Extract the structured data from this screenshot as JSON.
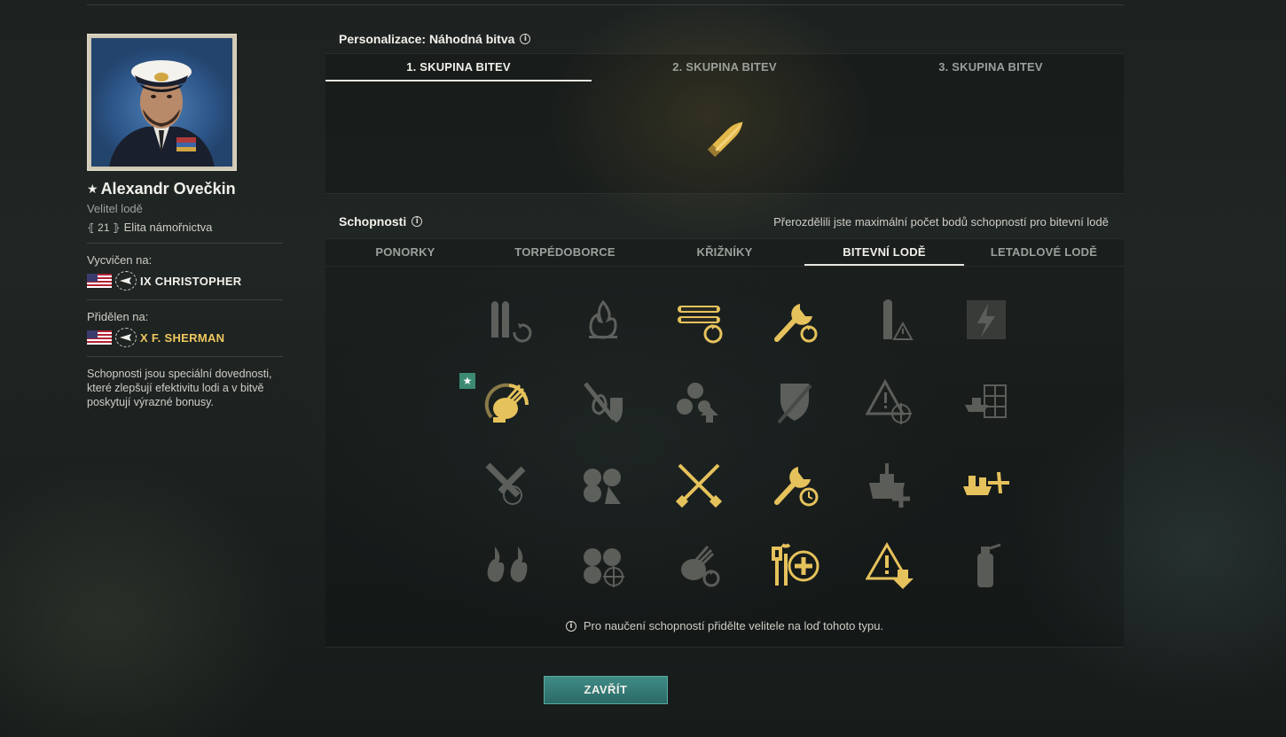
{
  "commander": {
    "name": "Alexandr Ovečkin",
    "role": "Velitel lodě",
    "level": "21",
    "rank_title": "Elita námořnictva",
    "trained_label": "Vycvičen na:",
    "trained_ship": "IX CHRISTOPHER",
    "assigned_label": "Přidělen na:",
    "assigned_ship": "X F. SHERMAN",
    "description": "Schopnosti jsou speciální dovednosti, které zlepšují efektivitu lodi a v bitvě poskytují výrazné bonusy."
  },
  "personalization": {
    "title": "Personalizace: Náhodná bitva",
    "tabs": [
      "1. SKUPINA BITEV",
      "2. SKUPINA BITEV",
      "3. SKUPINA BITEV"
    ],
    "active_tab": 0
  },
  "skills": {
    "title": "Schopnosti",
    "note": "Přerozdělili jste maximální počet bodů schopností pro bitevní lodě",
    "tabs": [
      "PONORKY",
      "TORPÉDOBORCE",
      "KŘIŽNÍKY",
      "BITEVNÍ LODĚ",
      "LETADLOVÉ LODĚ"
    ],
    "active_tab": 3,
    "grid": [
      [
        {
          "icon": "shells-reload-icon",
          "active": false
        },
        {
          "icon": "fire-icon",
          "active": false
        },
        {
          "icon": "torpedo-reload-icon",
          "active": true
        },
        {
          "icon": "wrench-reload-icon",
          "active": true
        },
        {
          "icon": "shell-warning-icon",
          "active": false
        },
        {
          "icon": "lightning-stripes-icon",
          "active": false
        }
      ],
      [
        {
          "icon": "aa-guns-icon",
          "active": true,
          "starred": true
        },
        {
          "icon": "fire-shield-icon",
          "active": false
        },
        {
          "icon": "propeller-up-icon",
          "active": false
        },
        {
          "icon": "shield-sword-icon",
          "active": false
        },
        {
          "icon": "warning-target-icon",
          "active": false
        },
        {
          "icon": "ship-grid-icon",
          "active": false
        }
      ],
      [
        {
          "icon": "crossed-shells-icon",
          "active": false
        },
        {
          "icon": "gun-sights-icon",
          "active": false
        },
        {
          "icon": "crossed-tools-icon",
          "active": true
        },
        {
          "icon": "wrench-timer-icon",
          "active": true
        },
        {
          "icon": "ship-heal-icon",
          "active": false
        },
        {
          "icon": "ship-plane-icon",
          "active": true
        }
      ],
      [
        {
          "icon": "fires-icon",
          "active": false
        },
        {
          "icon": "gun-targets-icon",
          "active": false
        },
        {
          "icon": "aa-reload-icon",
          "active": false
        },
        {
          "icon": "repair-plus-icon",
          "active": true
        },
        {
          "icon": "warning-down-icon",
          "active": true
        },
        {
          "icon": "extinguisher-icon",
          "active": false
        }
      ]
    ],
    "hint": "Pro naučení schopností přidělte velitele na loď tohoto typu."
  },
  "close_label": "ZAVŘÍT",
  "colors": {
    "accent": "#f0c860",
    "button": "#2f7470"
  }
}
